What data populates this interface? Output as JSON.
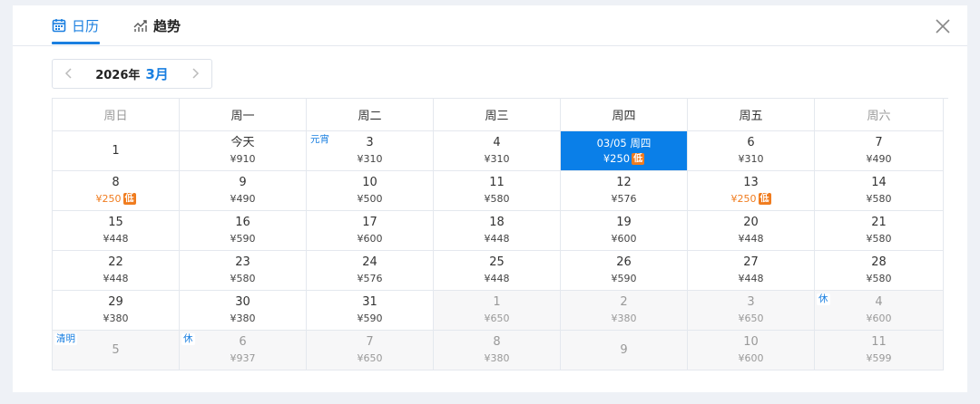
{
  "tabs": {
    "calendar": "日历",
    "trend": "趋势"
  },
  "nav": {
    "year": "2026年",
    "month": "3月"
  },
  "weekdays": [
    "周日",
    "周一",
    "周二",
    "周三",
    "周四",
    "周五",
    "周六"
  ],
  "low_badge": "低",
  "weeks": [
    [
      {
        "day": "1",
        "price": ""
      },
      {
        "day": "今天",
        "price": "¥910"
      },
      {
        "day": "3",
        "price": "¥310",
        "tag": "元宵"
      },
      {
        "day": "4",
        "price": "¥310"
      },
      {
        "day": "03/05 周四",
        "price": "¥250",
        "low": true,
        "selected": true
      },
      {
        "day": "6",
        "price": "¥310"
      },
      {
        "day": "7",
        "price": "¥490"
      }
    ],
    [
      {
        "day": "8",
        "price": "¥250",
        "low": true
      },
      {
        "day": "9",
        "price": "¥490"
      },
      {
        "day": "10",
        "price": "¥500"
      },
      {
        "day": "11",
        "price": "¥580"
      },
      {
        "day": "12",
        "price": "¥576"
      },
      {
        "day": "13",
        "price": "¥250",
        "low": true
      },
      {
        "day": "14",
        "price": "¥580"
      }
    ],
    [
      {
        "day": "15",
        "price": "¥448"
      },
      {
        "day": "16",
        "price": "¥590"
      },
      {
        "day": "17",
        "price": "¥600"
      },
      {
        "day": "18",
        "price": "¥448"
      },
      {
        "day": "19",
        "price": "¥600"
      },
      {
        "day": "20",
        "price": "¥448"
      },
      {
        "day": "21",
        "price": "¥580"
      }
    ],
    [
      {
        "day": "22",
        "price": "¥448"
      },
      {
        "day": "23",
        "price": "¥580"
      },
      {
        "day": "24",
        "price": "¥576"
      },
      {
        "day": "25",
        "price": "¥448"
      },
      {
        "day": "26",
        "price": "¥590"
      },
      {
        "day": "27",
        "price": "¥448"
      },
      {
        "day": "28",
        "price": "¥580"
      }
    ],
    [
      {
        "day": "29",
        "price": "¥380"
      },
      {
        "day": "30",
        "price": "¥380"
      },
      {
        "day": "31",
        "price": "¥590"
      },
      {
        "day": "1",
        "price": "¥650",
        "other": true
      },
      {
        "day": "2",
        "price": "¥380",
        "other": true
      },
      {
        "day": "3",
        "price": "¥650",
        "other": true
      },
      {
        "day": "4",
        "price": "¥600",
        "other": true,
        "tag": "休"
      }
    ],
    [
      {
        "day": "5",
        "price": "",
        "other": true,
        "tag": "清明"
      },
      {
        "day": "6",
        "price": "¥937",
        "other": true,
        "tag": "休"
      },
      {
        "day": "7",
        "price": "¥650",
        "other": true
      },
      {
        "day": "8",
        "price": "¥380",
        "other": true
      },
      {
        "day": "9",
        "price": "",
        "other": true
      },
      {
        "day": "10",
        "price": "¥600",
        "other": true
      },
      {
        "day": "11",
        "price": "¥599",
        "other": true
      }
    ]
  ],
  "colors": {
    "accent": "#1a7fe0",
    "selected_bg": "#0a7fe8",
    "low": "#f07c1f",
    "other_bg": "#f7f7f8"
  },
  "icons": {
    "calendar": "calendar-icon",
    "trend": "trend-chart-icon",
    "close": "close-icon",
    "prev": "chevron-left-icon",
    "next": "chevron-right-icon"
  }
}
